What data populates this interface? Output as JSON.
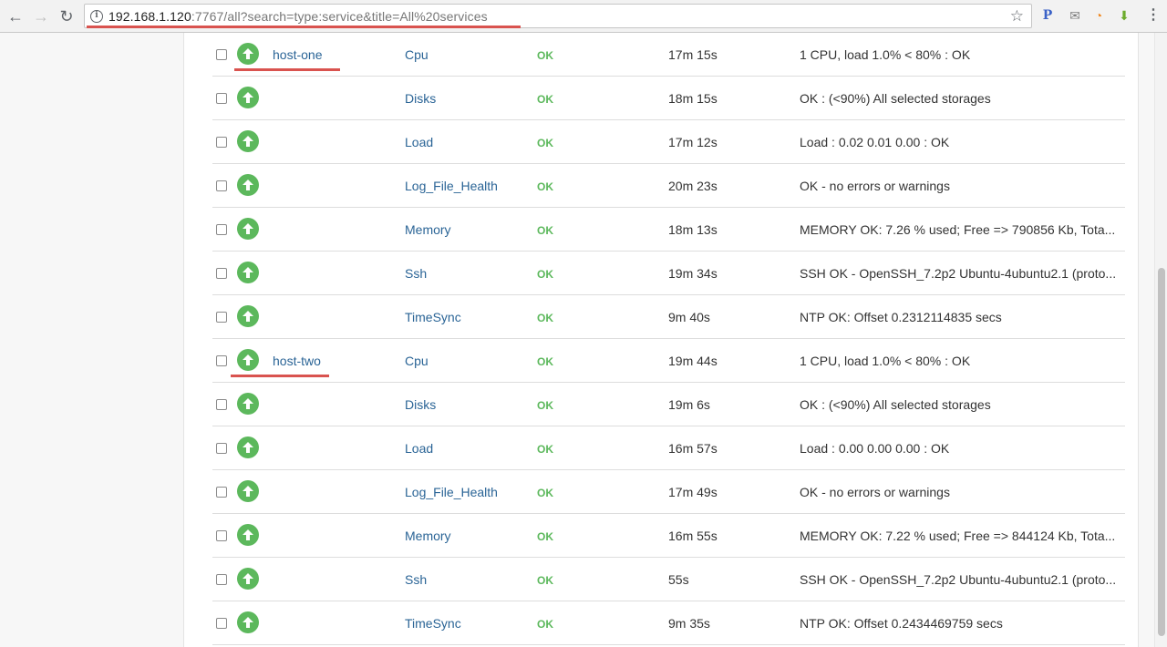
{
  "browser": {
    "url_host": "192.168.1.120",
    "url_rest": ":7767/all?search=type:service&title=All%20services",
    "nav_back": "←",
    "nav_forward": "→",
    "nav_reload": "↻",
    "star": "☆",
    "info": "i",
    "extensions": [
      "P",
      "✉",
      "◔",
      "⬇"
    ],
    "menu": "⋮",
    "icons": [
      "back-arrow-icon",
      "forward-arrow-icon",
      "reload-icon",
      "info-icon",
      "star-icon",
      "extension-icon",
      "mail-icon",
      "rss-icon",
      "download-icon",
      "menu-icon"
    ]
  },
  "accent_colors": {
    "ok": "#5cb85c",
    "link": "#2a6496",
    "annotation": "#d9534f"
  },
  "services": [
    {
      "host": "host-one",
      "service": "Cpu",
      "state": "OK",
      "duration": "17m 15s",
      "output": "1 CPU, load 1.0% < 80% : OK"
    },
    {
      "host": "",
      "service": "Disks",
      "state": "OK",
      "duration": "18m 15s",
      "output": "OK : (<90%) All selected storages"
    },
    {
      "host": "",
      "service": "Load",
      "state": "OK",
      "duration": "17m 12s",
      "output": "Load : 0.02 0.01 0.00 : OK"
    },
    {
      "host": "",
      "service": "Log_File_Health",
      "state": "OK",
      "duration": "20m 23s",
      "output": "OK - no errors or warnings"
    },
    {
      "host": "",
      "service": "Memory",
      "state": "OK",
      "duration": "18m 13s",
      "output": "MEMORY OK: 7.26 % used; Free => 790856 Kb, Tota..."
    },
    {
      "host": "",
      "service": "Ssh",
      "state": "OK",
      "duration": "19m 34s",
      "output": "SSH OK - OpenSSH_7.2p2 Ubuntu-4ubuntu2.1 (proto..."
    },
    {
      "host": "",
      "service": "TimeSync",
      "state": "OK",
      "duration": "9m 40s",
      "output": "NTP OK: Offset 0.2312114835 secs"
    },
    {
      "host": "host-two",
      "service": "Cpu",
      "state": "OK",
      "duration": "19m 44s",
      "output": "1 CPU, load 1.0% < 80% : OK"
    },
    {
      "host": "",
      "service": "Disks",
      "state": "OK",
      "duration": "19m 6s",
      "output": "OK : (<90%) All selected storages"
    },
    {
      "host": "",
      "service": "Load",
      "state": "OK",
      "duration": "16m 57s",
      "output": "Load : 0.00 0.00 0.00 : OK"
    },
    {
      "host": "",
      "service": "Log_File_Health",
      "state": "OK",
      "duration": "17m 49s",
      "output": "OK - no errors or warnings"
    },
    {
      "host": "",
      "service": "Memory",
      "state": "OK",
      "duration": "16m 55s",
      "output": "MEMORY OK: 7.22 % used; Free => 844124 Kb, Tota..."
    },
    {
      "host": "",
      "service": "Ssh",
      "state": "OK",
      "duration": "55s",
      "output": "SSH OK - OpenSSH_7.2p2 Ubuntu-4ubuntu2.1 (proto..."
    },
    {
      "host": "",
      "service": "TimeSync",
      "state": "OK",
      "duration": "9m 35s",
      "output": "NTP OK: Offset 0.2434469759 secs"
    }
  ]
}
